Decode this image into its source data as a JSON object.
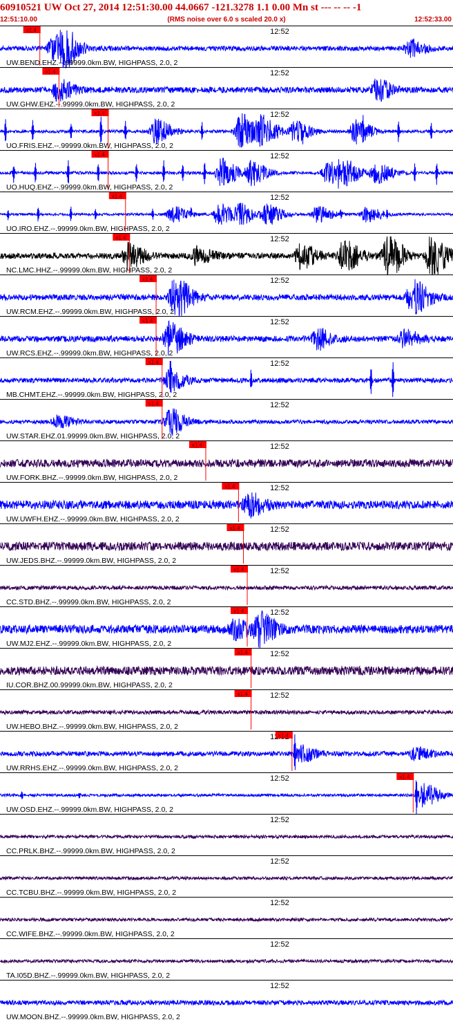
{
  "header": {
    "title": "60910521 UW Oct 27, 2014 12:51:30.00   44.0667 -121.3278  1.1 0.00 Mn st --- -- --   -1",
    "start_time": "12:51:10.00",
    "noise_note": "(RMS noise over 6.0 s scaled 20.0 x)",
    "end_time": "12:52:33.00"
  },
  "colors": {
    "blue_trace": "#0000ff",
    "black_trace": "#000000",
    "purple_trace": "#330055",
    "pick_marker": "#ff0000",
    "pick_label_text": "#660000",
    "label_text": "#000000",
    "divider": "#000000"
  },
  "chart_data": {
    "type": "line",
    "x_range_seconds": [
      0,
      83
    ],
    "minute_label": "12:52",
    "minute_mark_seconds": 50,
    "pick_label": "x1.4",
    "traces": [
      {
        "label": "UW.BEND.EHZ.--.99999.0km.BW, HIGHPASS, 2.0, 2",
        "color": "blue",
        "pick_seconds": 7.3,
        "bursts": [
          [
            11.5,
            0.9
          ],
          [
            9.5,
            0.5
          ],
          [
            75.0,
            0.4
          ]
        ],
        "noise": 0.12,
        "spikes": []
      },
      {
        "label": "UW.GHW.EHZ.--.99999.0km.BW, HIGHPASS, 2.0, 2",
        "color": "blue",
        "pick_seconds": 10.8,
        "bursts": [
          [
            10.5,
            0.5
          ],
          [
            69.0,
            0.5
          ]
        ],
        "noise": 0.15,
        "spikes": []
      },
      {
        "label": "UO.FRIS.EHZ.--.99999.0km.BW, HIGHPASS, 2.0, 2",
        "color": "blue",
        "pick_seconds": 19.8,
        "bursts": [
          [
            44.0,
            0.9
          ],
          [
            48.0,
            0.7
          ],
          [
            65.0,
            0.6
          ],
          [
            54.0,
            0.5
          ],
          [
            28.5,
            0.6
          ]
        ],
        "noise": 0.08,
        "spikes": [
          [
            1.0,
            0.7
          ],
          [
            6.0,
            0.6
          ],
          [
            13.0,
            0.5
          ],
          [
            18.5,
            0.8
          ],
          [
            23.0,
            0.5
          ],
          [
            37.0,
            0.5
          ],
          [
            55.5,
            0.6
          ],
          [
            66.5,
            0.7
          ],
          [
            73.0,
            0.6
          ],
          [
            79.0,
            0.5
          ]
        ]
      },
      {
        "label": "UO.HUQ.EHZ.--.99999.0km.BW, HIGHPASS, 2.0, 2",
        "color": "blue",
        "pick_seconds": 19.8,
        "bursts": [
          [
            40.5,
            0.7
          ],
          [
            46.0,
            0.6
          ],
          [
            60.0,
            0.6
          ],
          [
            69.0,
            0.5
          ],
          [
            63.5,
            0.5
          ]
        ],
        "noise": 0.08,
        "spikes": [
          [
            2.5,
            0.5
          ],
          [
            6.5,
            0.6
          ],
          [
            12.5,
            0.7
          ],
          [
            18.0,
            0.5
          ],
          [
            25.0,
            0.5
          ],
          [
            30.0,
            0.6
          ],
          [
            33.5,
            0.5
          ],
          [
            37.5,
            0.6
          ],
          [
            62.0,
            0.6
          ],
          [
            76.0,
            0.5
          ],
          [
            80.0,
            0.6
          ]
        ]
      },
      {
        "label": "UO.IRO.EHZ.--.99999.0km.BW, HIGHPASS, 2.0, 2",
        "color": "blue",
        "pick_seconds": 23.0,
        "bursts": [
          [
            40.0,
            0.5
          ],
          [
            44.0,
            0.5
          ],
          [
            49.0,
            0.5
          ],
          [
            58.0,
            0.4
          ],
          [
            67.0,
            0.4
          ],
          [
            31.5,
            0.4
          ]
        ],
        "noise": 0.06,
        "spikes": [
          [
            1.5,
            0.3
          ],
          [
            7.0,
            0.4
          ],
          [
            13.0,
            0.4
          ],
          [
            17.5,
            0.3
          ],
          [
            28.0,
            0.3
          ],
          [
            35.0,
            0.3
          ],
          [
            62.5,
            0.3
          ],
          [
            71.0,
            0.3
          ]
        ]
      },
      {
        "label": "NC.LMC.HHZ.--.99999.0km.BW, HIGHPASS, 2.0, 2",
        "color": "black",
        "pick_seconds": 23.7,
        "bursts": [
          [
            36.0,
            0.4
          ],
          [
            23.5,
            0.6
          ],
          [
            55.0,
            0.6
          ],
          [
            63.0,
            0.8
          ],
          [
            71.0,
            1.0
          ],
          [
            79.0,
            1.0
          ]
        ],
        "noise": 0.15,
        "spikes": []
      },
      {
        "label": "UW.RCM.EHZ.--.99999.0km.BW, HIGHPASS, 2.0, 2",
        "color": "blue",
        "pick_seconds": 28.6,
        "bursts": [
          [
            32.0,
            1.0
          ],
          [
            75.5,
            0.9
          ]
        ],
        "noise": 0.15,
        "spikes": []
      },
      {
        "label": "UW.RCS.EHZ.--.99999.0km.BW, HIGHPASS, 2.0, 2",
        "color": "blue",
        "pick_seconds": 28.6,
        "bursts": [
          [
            31.0,
            0.8
          ],
          [
            58.0,
            0.5
          ],
          [
            74.0,
            0.4
          ]
        ],
        "noise": 0.15,
        "spikes": []
      },
      {
        "label": "MB.CHMT.EHZ.--.99999.0km.BW, HIGHPASS, 2.0, 2",
        "color": "blue",
        "pick_seconds": 29.7,
        "bursts": [
          [
            31.0,
            0.5
          ]
        ],
        "noise": 0.12,
        "spikes": [
          [
            31.2,
            0.9
          ],
          [
            46.0,
            0.5
          ],
          [
            68.0,
            0.8
          ],
          [
            72.0,
            1.0
          ]
        ]
      },
      {
        "label": "UW.STAR.EHZ.01.99999.0km.BW, HIGHPASS, 2.0, 2",
        "color": "blue",
        "pick_seconds": 29.7,
        "bursts": [
          [
            31.0,
            0.7
          ],
          [
            10.5,
            0.3
          ]
        ],
        "noise": 0.1,
        "spikes": []
      },
      {
        "label": "UW.FORK.BHZ.--.99999.0km.BW, HIGHPASS, 2.0, 2",
        "color": "purple",
        "pick_seconds": 37.7,
        "bursts": [],
        "noise": 0.2,
        "spikes": []
      },
      {
        "label": "UW.UWFH.EHZ.--.99999.0km.BW, HIGHPASS, 2.0, 2",
        "color": "blue",
        "pick_seconds": 43.7,
        "bursts": [
          [
            45.5,
            0.5
          ]
        ],
        "noise": 0.22,
        "spikes": []
      },
      {
        "label": "UW.JEDS.BHZ.--.99999.0km.BW, HIGHPASS, 2.0, 2",
        "color": "purple",
        "pick_seconds": 44.6,
        "bursts": [],
        "noise": 0.22,
        "spikes": []
      },
      {
        "label": "CC.STD.BHZ.--.99999.0km.BW, HIGHPASS, 2.0, 2",
        "color": "purple",
        "pick_seconds": 45.3,
        "bursts": [],
        "noise": 0.1,
        "spikes": []
      },
      {
        "label": "UW.MJ2.EHZ.--.99999.0km.BW, HIGHPASS, 2.0, 2",
        "color": "blue",
        "pick_seconds": 45.3,
        "bursts": [
          [
            47.5,
            0.8
          ],
          [
            43.0,
            0.4
          ]
        ],
        "noise": 0.22,
        "spikes": []
      },
      {
        "label": "IU.COR.BHZ.00.99999.0km.BW, HIGHPASS, 2.0, 2",
        "color": "purple",
        "pick_seconds": 46.0,
        "bursts": [],
        "noise": 0.22,
        "spikes": []
      },
      {
        "label": "UW.HEBO.BHZ.--.99999.0km.BW, HIGHPASS, 2.0, 2",
        "color": "purple",
        "pick_seconds": 46.0,
        "bursts": [],
        "noise": 0.1,
        "spikes": []
      },
      {
        "label": "UW.RRHS.EHZ.--.99999.0km.BW, HIGHPASS, 2.0, 2",
        "color": "blue",
        "pick_seconds": 53.5,
        "bursts": [
          [
            55.0,
            0.4
          ],
          [
            76.0,
            0.3
          ]
        ],
        "noise": 0.12,
        "spikes": [
          [
            54.0,
            1.0
          ]
        ]
      },
      {
        "label": "UW.OSD.EHZ.--.99999.0km.BW, HIGHPASS, 2.0, 2",
        "color": "blue",
        "pick_seconds": 75.7,
        "bursts": [
          [
            77.5,
            0.6
          ]
        ],
        "noise": 0.07,
        "spikes": [
          [
            76.3,
            1.0
          ],
          [
            4.0,
            0.3
          ],
          [
            14.5,
            0.2
          ]
        ]
      },
      {
        "label": "CC.PRLK.BHZ.--.99999.0km.BW, HIGHPASS, 2.0, 2",
        "color": "purple",
        "pick_seconds": null,
        "bursts": [],
        "noise": 0.08,
        "spikes": []
      },
      {
        "label": "CC.TCBU.BHZ.--.99999.0km.BW, HIGHPASS, 2.0, 2",
        "color": "purple",
        "pick_seconds": null,
        "bursts": [],
        "noise": 0.08,
        "spikes": []
      },
      {
        "label": "CC.WIFE.BHZ.--.99999.0km.BW, HIGHPASS, 2.0, 2",
        "color": "purple",
        "pick_seconds": null,
        "bursts": [],
        "noise": 0.08,
        "spikes": []
      },
      {
        "label": "TA.I05D.BHZ.--.99999.0km.BW, HIGHPASS, 2.0, 2",
        "color": "purple",
        "pick_seconds": null,
        "bursts": [],
        "noise": 0.08,
        "spikes": []
      },
      {
        "label": "UW.MOON.BHZ.--.99999.0km.BW, HIGHPASS, 2.0, 2",
        "color": "blue",
        "pick_seconds": null,
        "bursts": [],
        "noise": 0.12,
        "spikes": []
      }
    ]
  }
}
